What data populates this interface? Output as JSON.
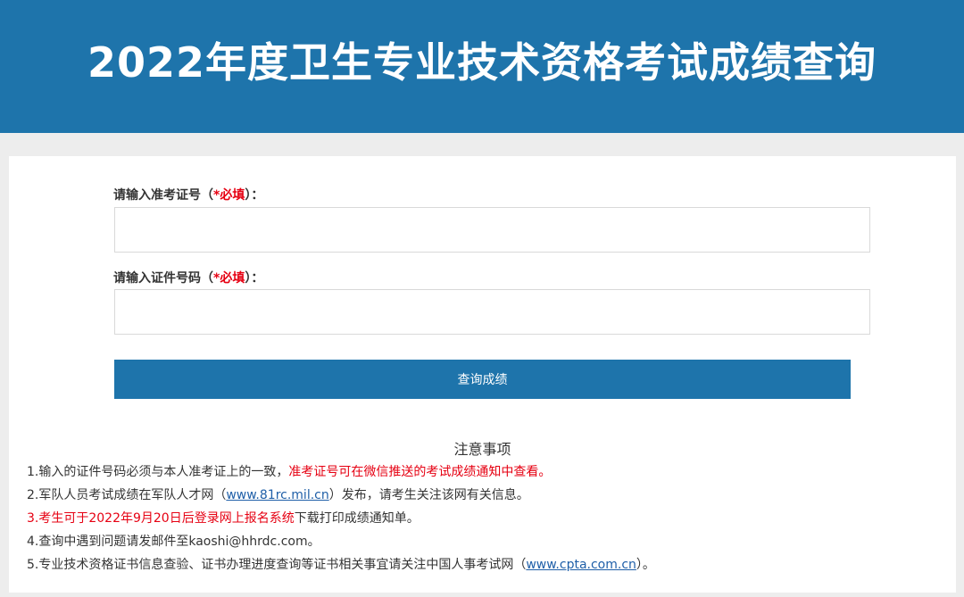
{
  "header": {
    "title": "2022年度卫生专业技术资格考试成绩查询"
  },
  "form": {
    "exam_no": {
      "label": "请输入准考证号（",
      "required": "*必填",
      "suffix": "）：",
      "value": "",
      "placeholder": ""
    },
    "id_no": {
      "label": "请输入证件号码（",
      "required": "*必填",
      "suffix": "）：",
      "value": "",
      "placeholder": ""
    },
    "submit_label": "查询成绩"
  },
  "notes": {
    "title": "注意事项",
    "item1": {
      "text": "1.输入的证件号码必须与本人准考证上的一致，",
      "highlight": "准考证号可在微信推送的考试成绩通知中查看。"
    },
    "item2": {
      "pre": "2.军队人员考试成绩在军队人才网（",
      "link": "www.81rc.mil.cn",
      "post": "）发布，请考生关注该网有关信息。"
    },
    "item3": {
      "pre": "3.考生可于",
      "highlight": "2022年9月20日后登录网上报名系统",
      "post": "下载打印成绩通知单。"
    },
    "item4": {
      "text": "4.查询中遇到问题请发邮件至kaoshi@hhrdc.com。"
    },
    "item5": {
      "pre": "5.专业技术资格证书信息查验、证书办理进度查询等证书相关事宜请关注中国人事考试网（",
      "link": "www.cpta.com.cn",
      "post": "）。"
    }
  },
  "colors": {
    "brand_blue": "#1e74ab",
    "required_red": "#e60012",
    "link_blue": "#1f5fa8",
    "page_bg": "#ededed"
  }
}
